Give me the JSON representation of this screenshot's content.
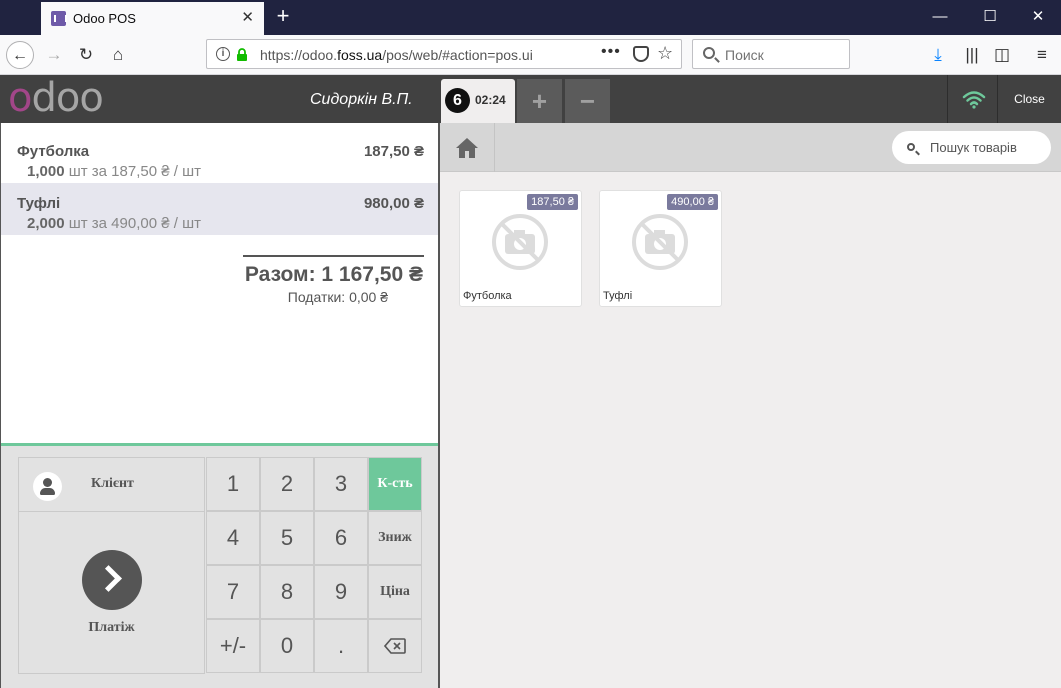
{
  "browser": {
    "tab_title": "Odoo POS",
    "url_prefix": "https://odoo.",
    "url_domain": "foss.ua",
    "url_rest": "/pos/web/#action=pos.ui",
    "search_placeholder": "Поиск"
  },
  "pos": {
    "cashier": "Сидоркін В.П.",
    "order": {
      "number": "6",
      "time": "02:24"
    },
    "add_order": "+",
    "remove_order": "−",
    "close_label": "Close",
    "connection_color": "#6ec89b"
  },
  "orderlines": [
    {
      "name": "Футболка",
      "price": "187,50 ₴",
      "qty": "1,000",
      "unit_text": "шт за 187,50 ₴ / шт",
      "selected": false
    },
    {
      "name": "Туфлі",
      "price": "980,00 ₴",
      "qty": "2,000",
      "unit_text": "шт за 490,00 ₴ / шт",
      "selected": true
    }
  ],
  "summary": {
    "total": "Разом: 1 167,50 ₴",
    "taxes": "Податки: 0,00 ₴"
  },
  "controls": {
    "client_label": "Клієнт",
    "payment_label": "Платіж",
    "keys": [
      "1",
      "2",
      "3",
      "4",
      "5",
      "6",
      "7",
      "8",
      "9",
      "+/-",
      "0",
      "."
    ],
    "modes": {
      "quantity": "К-сть",
      "discount": "Зниж",
      "price": "Ціна"
    }
  },
  "products_search_placeholder": "Пошук товарів",
  "products": [
    {
      "name": "Футболка",
      "price": "187,50 ₴"
    },
    {
      "name": "Туфлі",
      "price": "490,00 ₴"
    }
  ]
}
